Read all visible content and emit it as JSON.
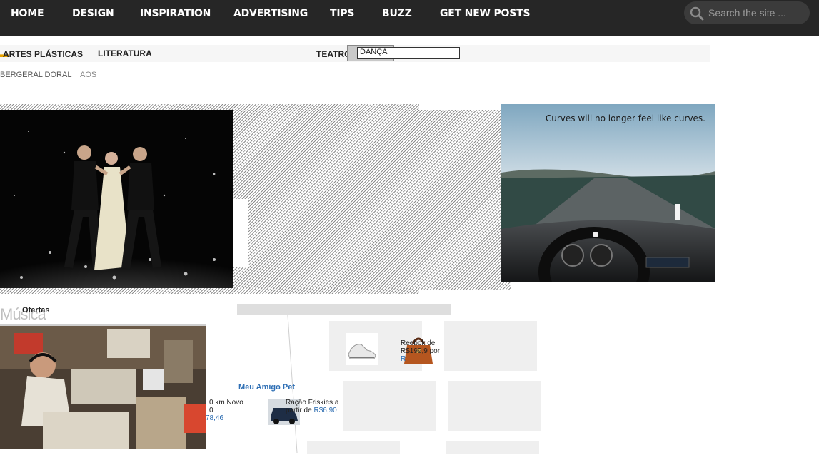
{
  "topnav": {
    "items": [
      "HOME",
      "DESIGN",
      "INSPIRATION",
      "ADVERTISING",
      "TIPS",
      "BUZZ",
      "GET NEW POSTS"
    ],
    "search_placeholder": "Search the site ..."
  },
  "categories": {
    "artes_plasticas": "ARTES PLÁSTICAS",
    "literatura": "LITERATURA",
    "teatro": "TEATRO E",
    "danca": "DANÇA"
  },
  "subline": "BERGERAL DORAL",
  "subline_extra": "AOS",
  "ad": {
    "caption": "Curves will no longer feel like curves."
  },
  "bottom": {
    "ghost_title": "Música",
    "ofertas": "Ofertas",
    "meu_amigo_pet": "Meu Amigo Pet",
    "car_line1": "0 km Novo",
    "car_line2": "0",
    "car_price": "78,46",
    "racao_line1": "Ração Friskies a",
    "racao_line2": "partir de",
    "racao_price": "R$6,90",
    "reebok_line1": "Reebok de",
    "reebok_line2": "R$199,9 por",
    "reebok_price": "R"
  }
}
